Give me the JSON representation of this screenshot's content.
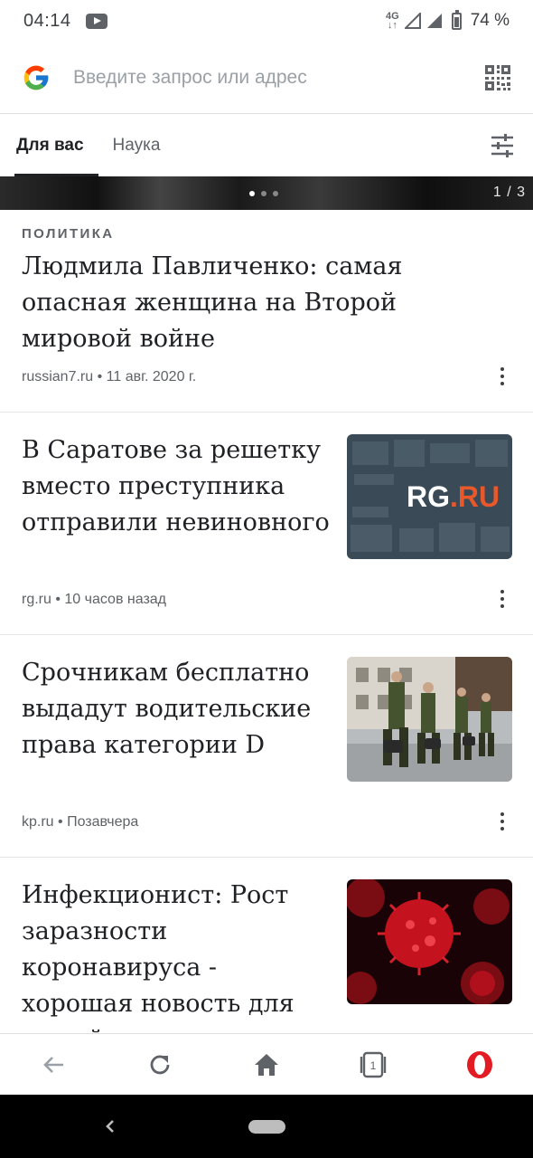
{
  "status_bar": {
    "time": "04:14",
    "network": "4G",
    "battery": "74 %",
    "youtube_icon": "youtube-icon"
  },
  "search": {
    "placeholder": "Введите запрос или адрес",
    "logo_icon": "google-logo",
    "qr_icon": "qr-code-icon"
  },
  "tabs": {
    "items": [
      {
        "label": "Для вас",
        "active": true
      },
      {
        "label": "Наука",
        "active": false
      }
    ],
    "settings_icon": "sliders-icon"
  },
  "hero": {
    "counter": "1 / 3",
    "dots": 3,
    "active_dot": 1
  },
  "feed": {
    "main": {
      "category": "ПОЛИТИКА",
      "headline": "Людмила Павличенко: самая опасная женщина на Второй мировой войне",
      "meta": "russian7.ru • 11 авг. 2020 г."
    },
    "articles": [
      {
        "headline": "В Саратове за решетку вместо преступника отправили невиновного",
        "meta": "rg.ru • 10 часов назад",
        "thumb_text": "RG.RU"
      },
      {
        "headline": "Срочникам бесплатно выдадут водительские права категории D",
        "meta": "kp.ru • Позавчера"
      },
      {
        "headline": "Инфекционист: Рост заразности коронавируса - хорошая новость для людей",
        "meta": ""
      }
    ]
  },
  "bottom_nav": {
    "items": [
      "back-arrow-icon",
      "reload-icon",
      "home-icon",
      "tabs-icon",
      "opera-logo-icon"
    ],
    "tabs_count": "1"
  },
  "colors": {
    "accent_red": "#e31c23",
    "text_primary": "#202124",
    "text_secondary": "#5f6368"
  }
}
